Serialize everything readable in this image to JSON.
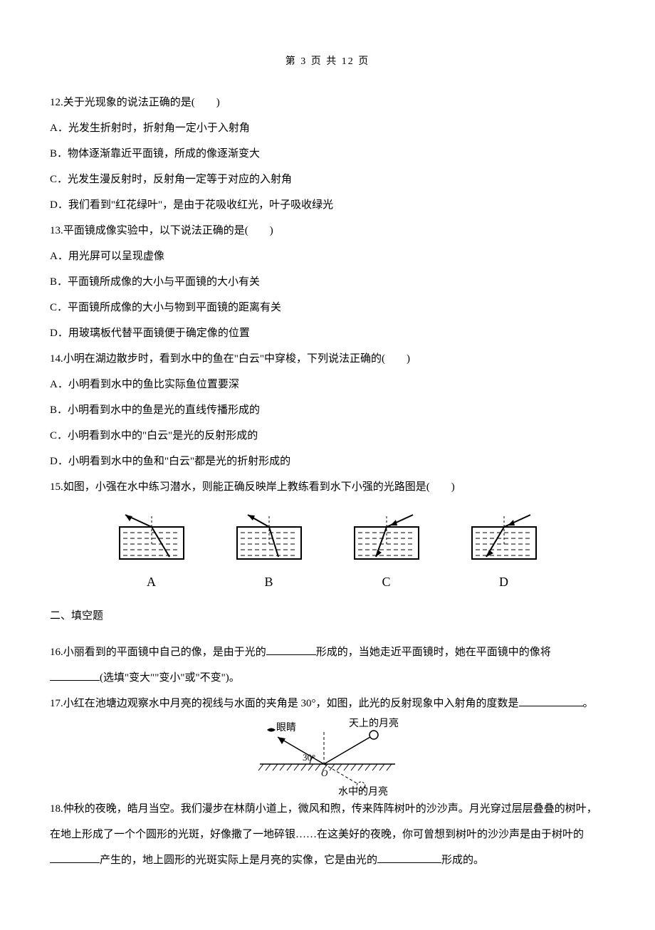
{
  "header": "第 3 页 共 12 页",
  "q12": {
    "stem": "12.关于光现象的说法正确的是(　　)",
    "A": "A．光发生折射时，折射角一定小于入射角",
    "B": "B．物体逐渐靠近平面镜，所成的像逐渐变大",
    "C": "C．光发生漫反射时，反射角一定等于对应的入射角",
    "D": "D．我们看到\"红花绿叶\"，是由于花吸收红光，叶子吸收绿光"
  },
  "q13": {
    "stem": "13.平面镜成像实验中，以下说法正确的是(　　)",
    "A": "A．用光屏可以呈现虚像",
    "B": "B．平面镜所成像的大小与平面镜的大小有关",
    "C": "C．平面镜所成像的大小与物到平面镜的距离有关",
    "D": "D．用玻璃板代替平面镜便于确定像的位置"
  },
  "q14": {
    "stem": "14.小明在湖边散步时，看到水中的鱼在\"白云\"中穿梭，下列说法正确的(　　)",
    "A": "A．小明看到水中的鱼比实际鱼位置要深",
    "B": "B．小明看到水中的鱼是光的直线传播形成的",
    "C": "C．小明看到水中的\"白云\"是光的反射形成的",
    "D": "D．小明看到水中的鱼和\"白云\"都是光的折射形成的"
  },
  "q15": {
    "stem": "15.如图，小强在水中练习潜水，则能正确反映岸上教练看到水下小强的光路图是(　　)",
    "labels": {
      "A": "A",
      "B": "B",
      "C": "C",
      "D": "D"
    }
  },
  "section2": "二、填空题",
  "q16": {
    "p1a": "16.小丽看到的平面镜中自己的像，是由于光的",
    "p1b": "形成的，当她走近平面镜时，她在平面镜中的像将",
    "p2b": "(选填\"变大\"\"变小\"或\"不变\")。"
  },
  "q17": {
    "a": "17.小红在池塘边观察水中月亮的视线与水面的夹角是 30°，如图，此光的反射现象中入射角的度数是",
    "b": "。",
    "labels": {
      "eye": "眼睛",
      "moon_sky": "天上的月亮",
      "angle": "30°",
      "O": "O",
      "moon_water": "水中的月亮"
    }
  },
  "q18": {
    "p1": "18.仲秋的夜晚，皓月当空。我们漫步在林荫小道上，微风和煦，传来阵阵树叶的沙沙声。月光穿过层层叠叠的树叶，在地上形成了一个个圆形的光斑，好像撒了一地碎银……在这美好的夜晚，你可曾想到树叶的沙沙声是由于树叶的",
    "p2": "产生的，地上圆形的光斑实际上是月亮的实像，它是由光的",
    "p3": "形成的。"
  }
}
